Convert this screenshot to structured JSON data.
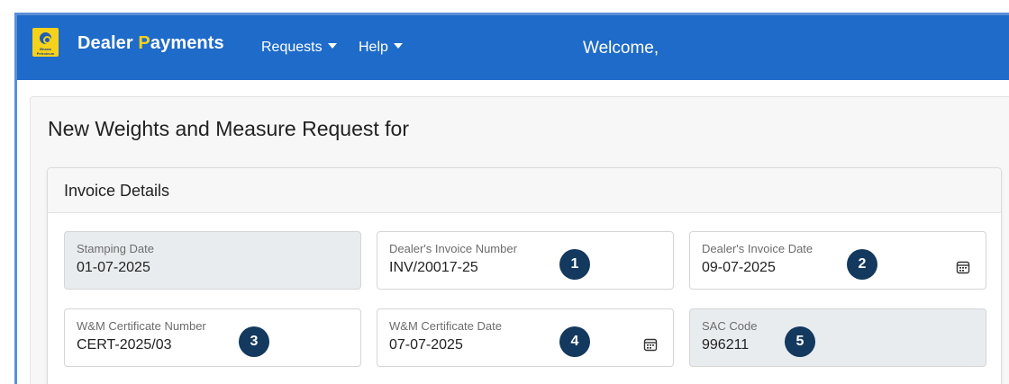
{
  "app": {
    "logo_text": "Bharat Petroleum",
    "brand_part1": "Dealer ",
    "brand_p": "P",
    "brand_part2": "ayments",
    "welcome": "Welcome,"
  },
  "nav": {
    "requests": "Requests",
    "help": "Help"
  },
  "page": {
    "title": "New Weights and Measure Request for"
  },
  "section": {
    "title": "Invoice Details"
  },
  "fields": {
    "stamping_date": {
      "label": "Stamping Date",
      "value": "01-07-2025"
    },
    "invoice_number": {
      "label": "Dealer's Invoice Number",
      "value": "INV/20017-25",
      "marker": "1"
    },
    "invoice_date": {
      "label": "Dealer's Invoice Date",
      "value": "09-07-2025",
      "marker": "2"
    },
    "certificate_number": {
      "label": "W&M Certificate Number",
      "value": "CERT-2025/03",
      "marker": "3"
    },
    "certificate_date": {
      "label": "W&M Certificate Date",
      "value": "07-07-2025",
      "marker": "4"
    },
    "sac_code": {
      "label": "SAC Code",
      "value": "996211",
      "marker": "5"
    }
  },
  "colors": {
    "navbar": "#1f6bc9",
    "brand_accent": "#f7d21a",
    "marker": "#14395e",
    "disabled_field": "#e9ecef"
  },
  "icons": {
    "date_picker": "calendar-icon"
  }
}
